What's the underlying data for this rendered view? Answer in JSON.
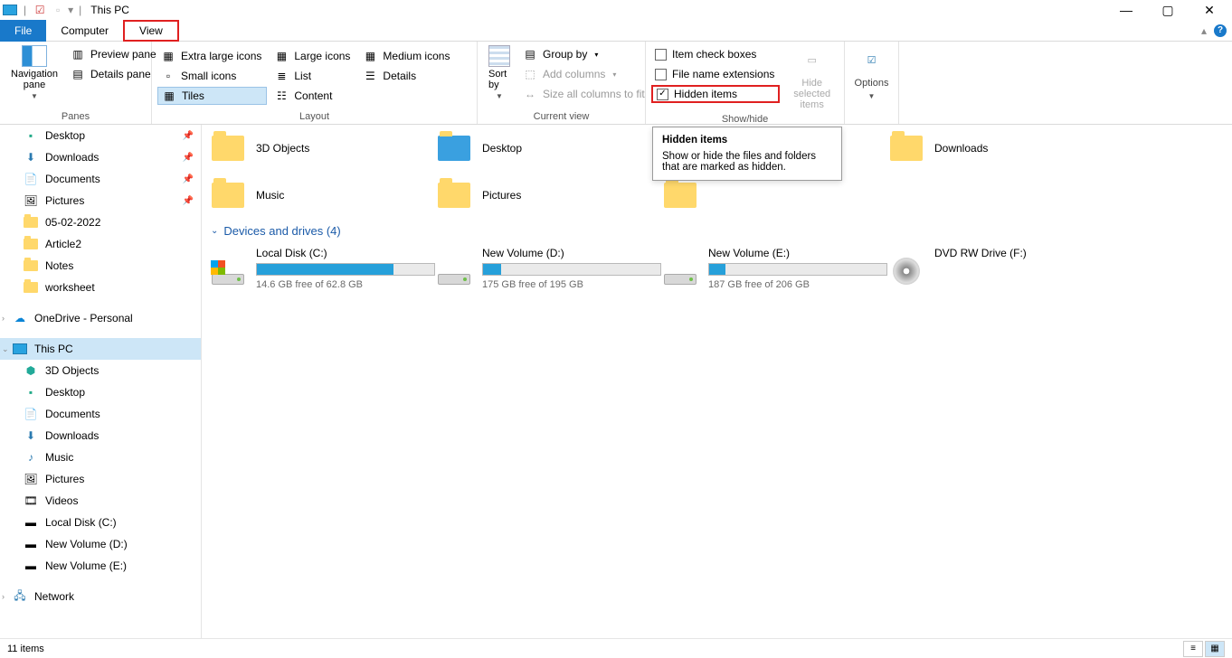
{
  "title": "This PC",
  "tabs": {
    "file": "File",
    "computer": "Computer",
    "view": "View"
  },
  "ribbon": {
    "panes": {
      "label": "Panes",
      "nav": "Navigation pane",
      "preview": "Preview pane",
      "details": "Details pane"
    },
    "layout": {
      "label": "Layout",
      "xl": "Extra large icons",
      "lg": "Large icons",
      "md": "Medium icons",
      "sm": "Small icons",
      "list": "List",
      "details": "Details",
      "tiles": "Tiles",
      "content": "Content"
    },
    "currentview": {
      "label": "Current view",
      "sort": "Sort by",
      "group": "Group by",
      "addcols": "Add columns",
      "sizeall": "Size all columns to fit"
    },
    "showhide": {
      "label": "Show/hide",
      "checkboxes": "Item check boxes",
      "ext": "File name extensions",
      "hidden": "Hidden items",
      "hideselected": "Hide selected items"
    },
    "options": "Options"
  },
  "tooltip": {
    "title": "Hidden items",
    "body": "Show or hide the files and folders that are marked as hidden."
  },
  "nav": {
    "desktop": "Desktop",
    "downloads": "Downloads",
    "documents": "Documents",
    "pictures": "Pictures",
    "f1": "05-02-2022",
    "f2": "Article2",
    "f3": "Notes",
    "f4": "worksheet",
    "onedrive": "OneDrive - Personal",
    "thispc": "This PC",
    "objects3d": "3D Objects",
    "music": "Music",
    "videos": "Videos",
    "localc": "Local Disk (C:)",
    "vold": "New Volume (D:)",
    "vole": "New Volume (E:)",
    "network": "Network"
  },
  "folders": {
    "objects3d": "3D Objects",
    "desktop": "Desktop",
    "downloads": "Downloads",
    "music": "Music",
    "pictures": "Pictures"
  },
  "section": "Devices and drives (4)",
  "drives": {
    "c": {
      "name": "Local Disk (C:)",
      "sub": "14.6 GB free of 62.8 GB",
      "fill": 77
    },
    "d": {
      "name": "New Volume (D:)",
      "sub": "175 GB free of 195 GB",
      "fill": 10
    },
    "e": {
      "name": "New Volume (E:)",
      "sub": "187 GB free of 206 GB",
      "fill": 9
    },
    "f": {
      "name": "DVD RW Drive (F:)"
    }
  },
  "status": "11 items"
}
